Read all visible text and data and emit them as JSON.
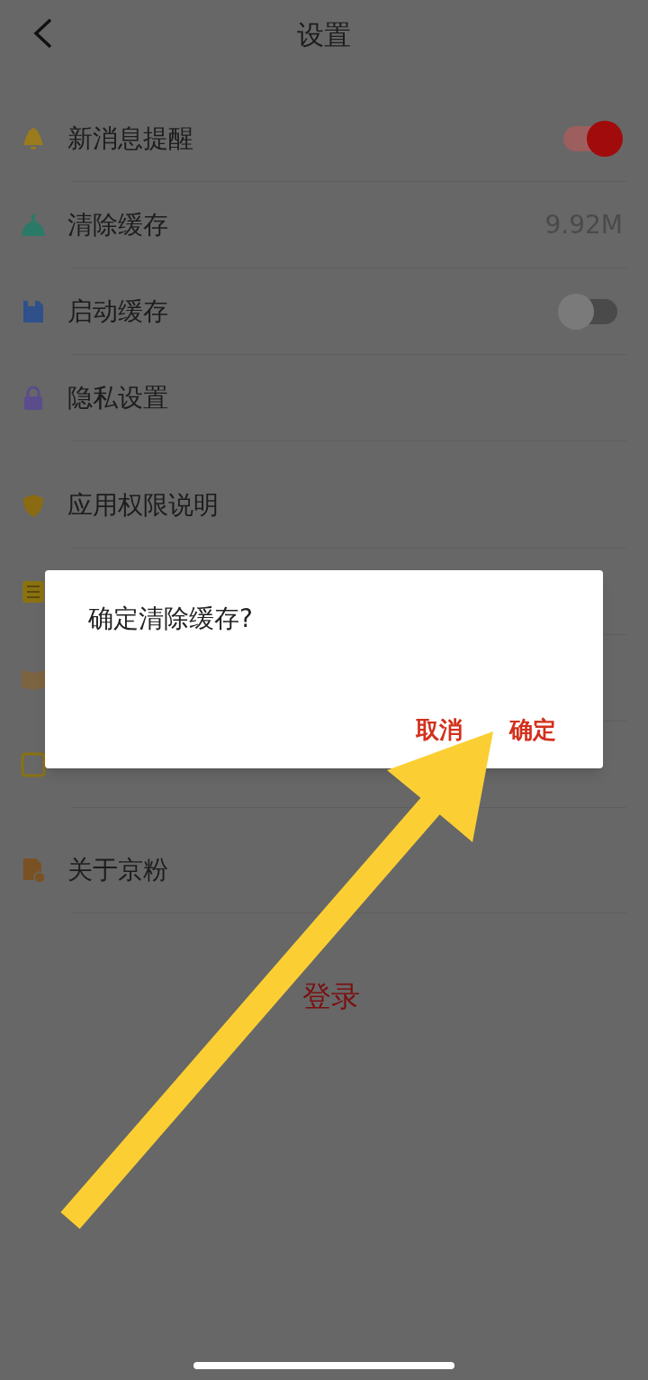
{
  "header": {
    "title": "设置"
  },
  "groups": [
    {
      "items": [
        {
          "kind": "toggle",
          "label": "新消息提醒",
          "on": true
        },
        {
          "kind": "value",
          "label": "清除缓存",
          "value": "9.92M"
        },
        {
          "kind": "toggle",
          "label": "启动缓存",
          "on": false
        },
        {
          "kind": "plain",
          "label": "隐私设置"
        }
      ]
    },
    {
      "items": [
        {
          "kind": "plain",
          "label": "应用权限说明"
        },
        {
          "kind": "plain"
        },
        {
          "kind": "plain"
        },
        {
          "kind": "plain"
        }
      ]
    },
    {
      "items": [
        {
          "kind": "plain",
          "label": "关于京粉"
        }
      ]
    }
  ],
  "logout": {
    "label": "登录"
  },
  "dialog": {
    "message": "确定清除缓存?",
    "buttons": [
      "取消",
      "确定"
    ]
  }
}
